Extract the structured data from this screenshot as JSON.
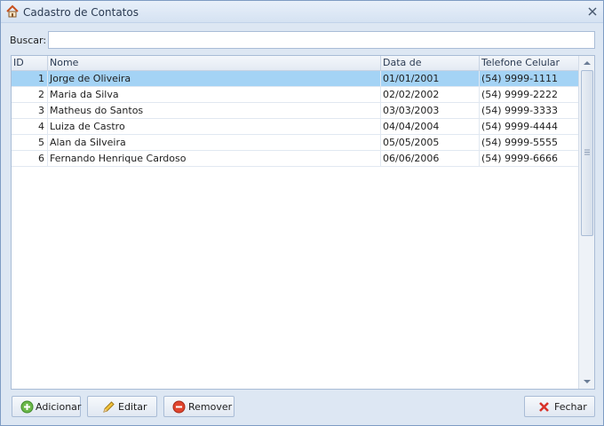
{
  "window": {
    "title": "Cadastro de Contatos"
  },
  "search": {
    "label": "Buscar:",
    "value": "",
    "placeholder": ""
  },
  "grid": {
    "columns": [
      "ID",
      "Nome",
      "Data de Nascimento",
      "Telefone Celular"
    ],
    "rows": [
      {
        "id": "1",
        "nome": "Jorge de Oliveira",
        "data": "01/01/2001",
        "tel": "(54) 9999-1111"
      },
      {
        "id": "2",
        "nome": "Maria da Silva",
        "data": "02/02/2002",
        "tel": "(54) 9999-2222"
      },
      {
        "id": "3",
        "nome": "Matheus do Santos",
        "data": "03/03/2003",
        "tel": "(54) 9999-3333"
      },
      {
        "id": "4",
        "nome": "Luiza de Castro",
        "data": "04/04/2004",
        "tel": "(54) 9999-4444"
      },
      {
        "id": "5",
        "nome": "Alan da Silveira",
        "data": "05/05/2005",
        "tel": "(54) 9999-5555"
      },
      {
        "id": "6",
        "nome": "Fernando Henrique Cardoso",
        "data": "06/06/2006",
        "tel": "(54) 9999-6666"
      }
    ]
  },
  "buttons": {
    "adicionar": "Adicionar",
    "editar": "Editar",
    "remover": "Remover",
    "fechar": "Fechar"
  },
  "icons": {
    "app": "house-icon",
    "close": "close-icon",
    "adicionar": "plus-circle-icon",
    "editar": "pencil-icon",
    "remover": "minus-circle-icon",
    "fechar": "red-x-icon"
  },
  "colors": {
    "selected_row": "#a4d3f5",
    "window_bg": "#dde7f3"
  }
}
